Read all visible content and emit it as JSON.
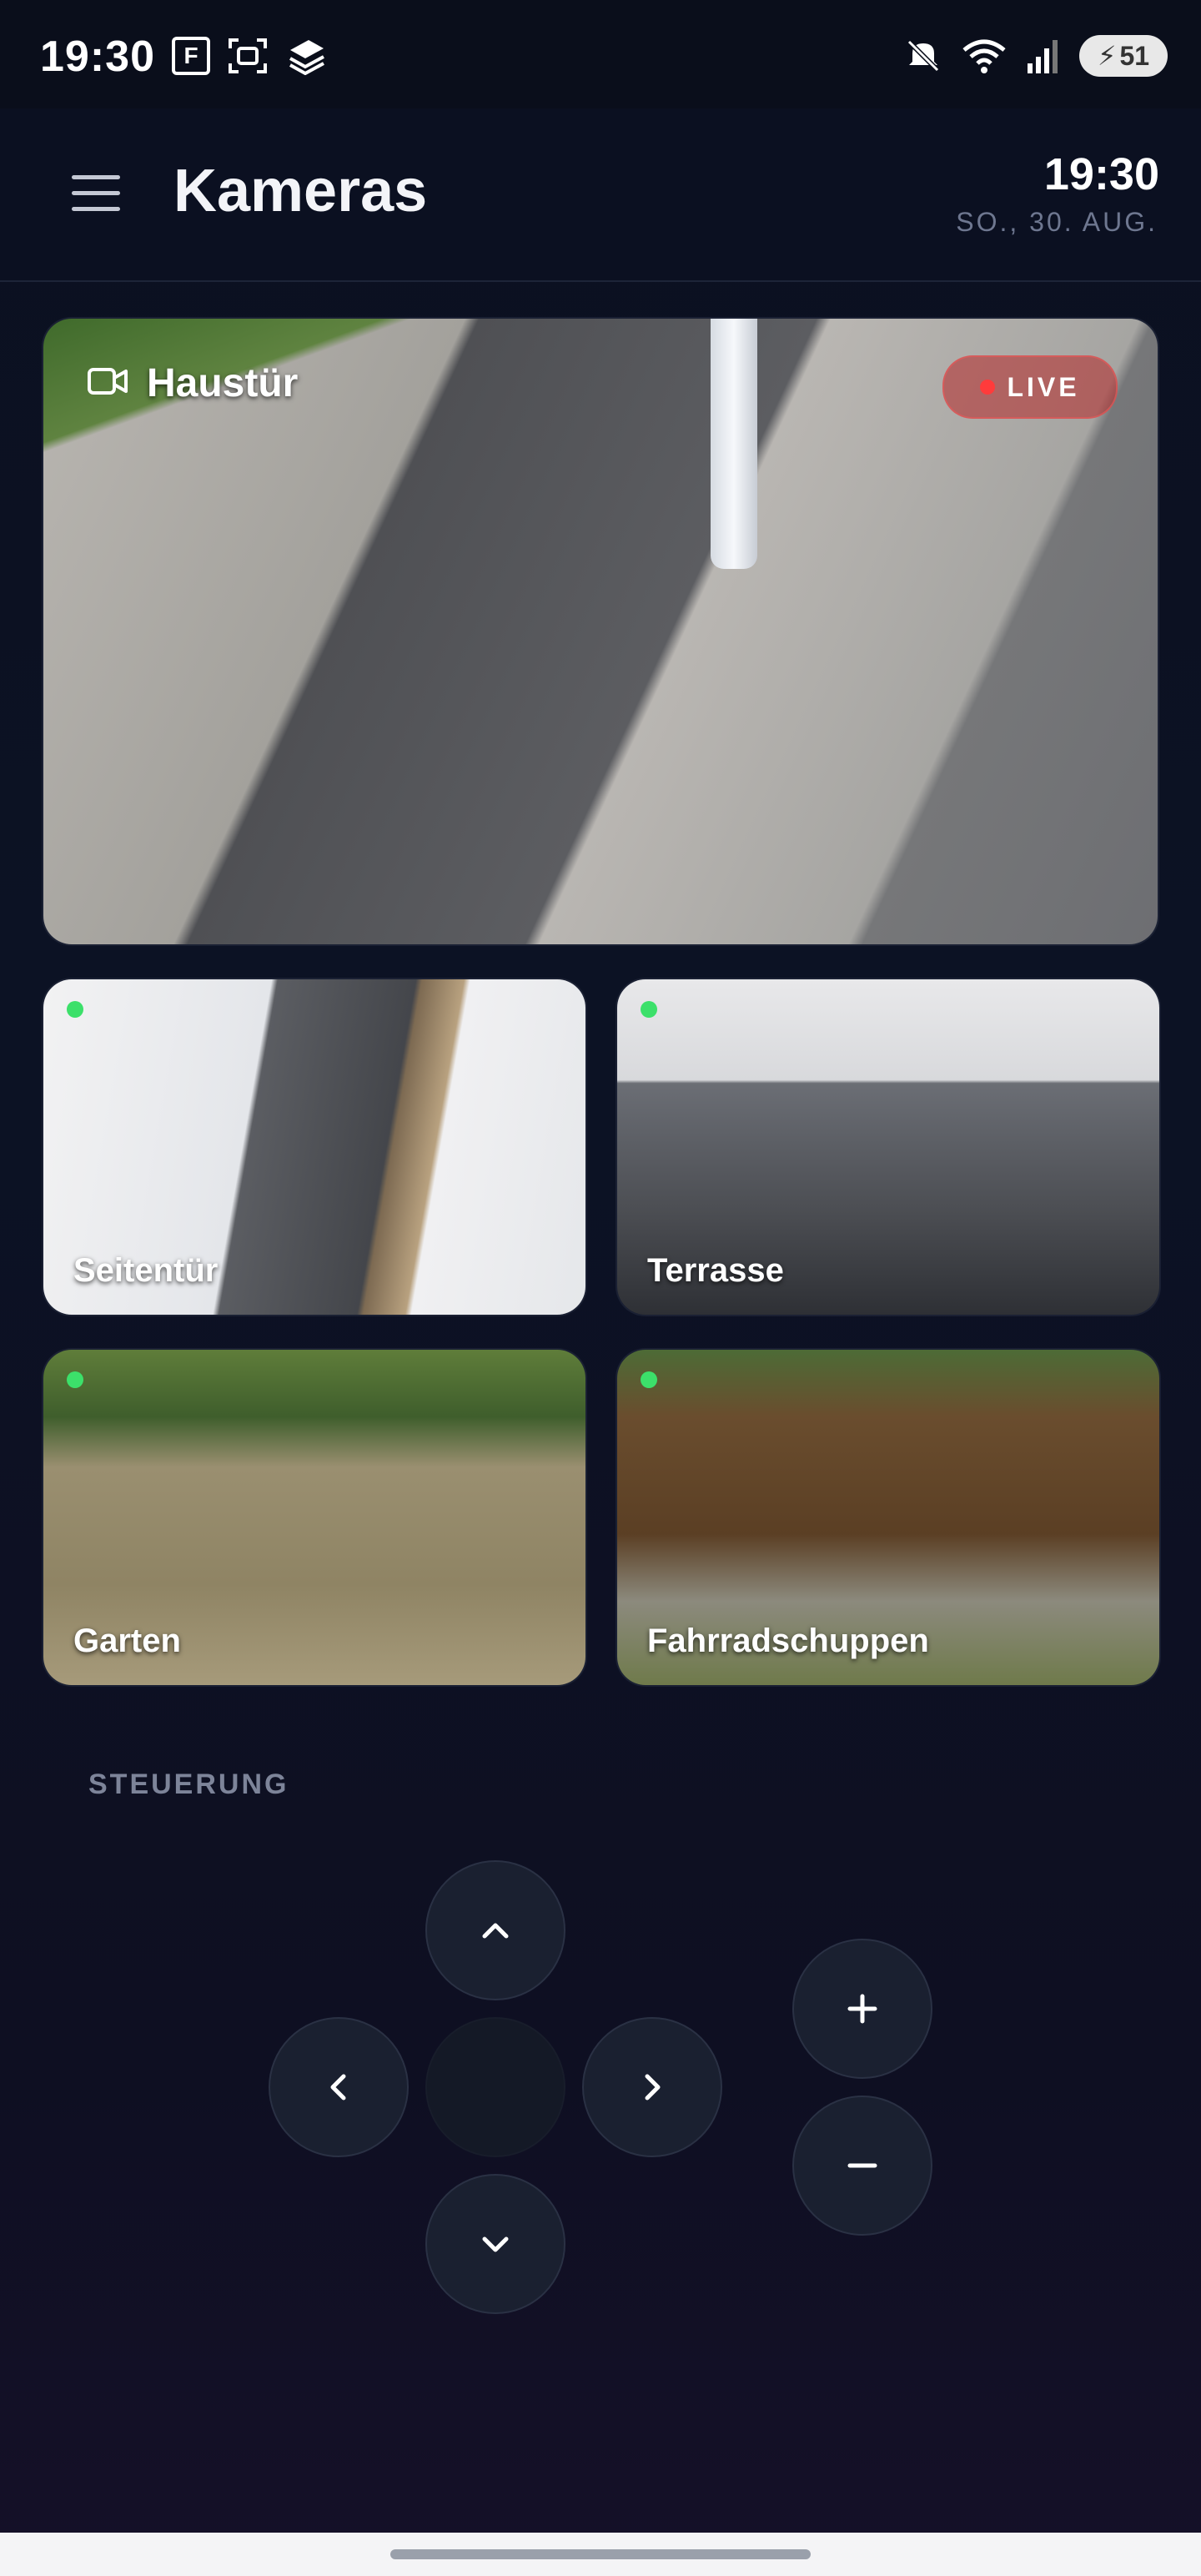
{
  "status_bar": {
    "time": "19:30",
    "battery": "51",
    "icons_left": [
      "f-app-icon",
      "image-scan-icon",
      "stacked-app-icon"
    ],
    "icons_right": [
      "mute-icon",
      "wifi-icon",
      "signal-icon",
      "battery-icon"
    ]
  },
  "header": {
    "title": "Kameras",
    "clock": "19:30",
    "date": "SO., 30. AUG."
  },
  "main_camera": {
    "name": "Haustür",
    "badge": "LIVE"
  },
  "cameras": [
    {
      "name": "Seitentür",
      "online": true
    },
    {
      "name": "Terrasse",
      "online": true
    },
    {
      "name": "Garten",
      "online": true
    },
    {
      "name": "Fahrradschuppen",
      "online": true
    }
  ],
  "controls": {
    "section_title": "STEUERUNG",
    "buttons": [
      "up",
      "left",
      "center",
      "right",
      "down",
      "zoom-in",
      "zoom-out"
    ]
  },
  "colors": {
    "background": "#0b1020",
    "live_badge": "#b42828",
    "online_dot": "#3ce06a",
    "control_button": "#1a2030"
  }
}
